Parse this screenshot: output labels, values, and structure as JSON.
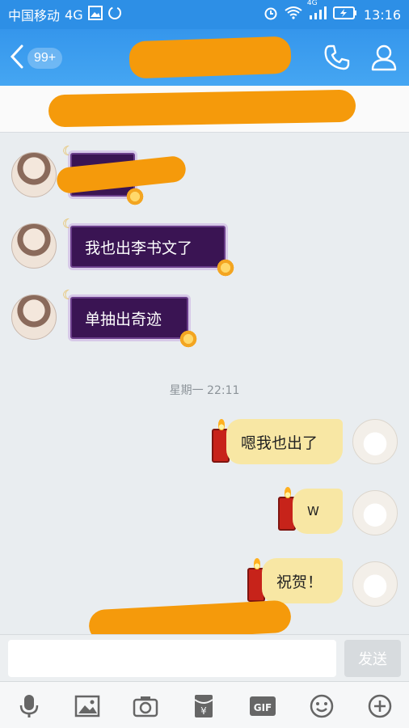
{
  "status_bar": {
    "carrier": "中国移动",
    "network": "4G",
    "signal_tag": "4G",
    "time": "13:16",
    "icons": [
      "gallery-icon",
      "sync-icon",
      "alarm-icon",
      "wifi-icon",
      "signal-icon",
      "battery-charging-icon"
    ]
  },
  "nav": {
    "unread_badge": "99+",
    "title": "",
    "icons": [
      "back-chevron-icon",
      "phone-icon",
      "profile-icon"
    ]
  },
  "messages": [
    {
      "side": "left",
      "text": ""
    },
    {
      "side": "left",
      "text": "我也出李书文了"
    },
    {
      "side": "left",
      "text": "单抽出奇迹"
    },
    {
      "side": "right",
      "text": "嗯我也出了"
    },
    {
      "side": "right",
      "text": "W"
    },
    {
      "side": "right",
      "text": "祝贺！"
    }
  ],
  "time_separator": "星期一 22:11",
  "input": {
    "placeholder": "",
    "send_label": "发送"
  },
  "toolbar": {
    "items": [
      "microphone-icon",
      "image-icon",
      "camera-icon",
      "red-packet-icon",
      "gif-icon",
      "emoji-icon",
      "plus-icon"
    ],
    "red_packet_glyph": "¥",
    "gif_label": "GIF"
  },
  "colors": {
    "accent": "#3596ec",
    "redaction": "#f59a0b",
    "purple_bubble": "#3a1453",
    "yellow_bubble": "#f8e7a4"
  }
}
